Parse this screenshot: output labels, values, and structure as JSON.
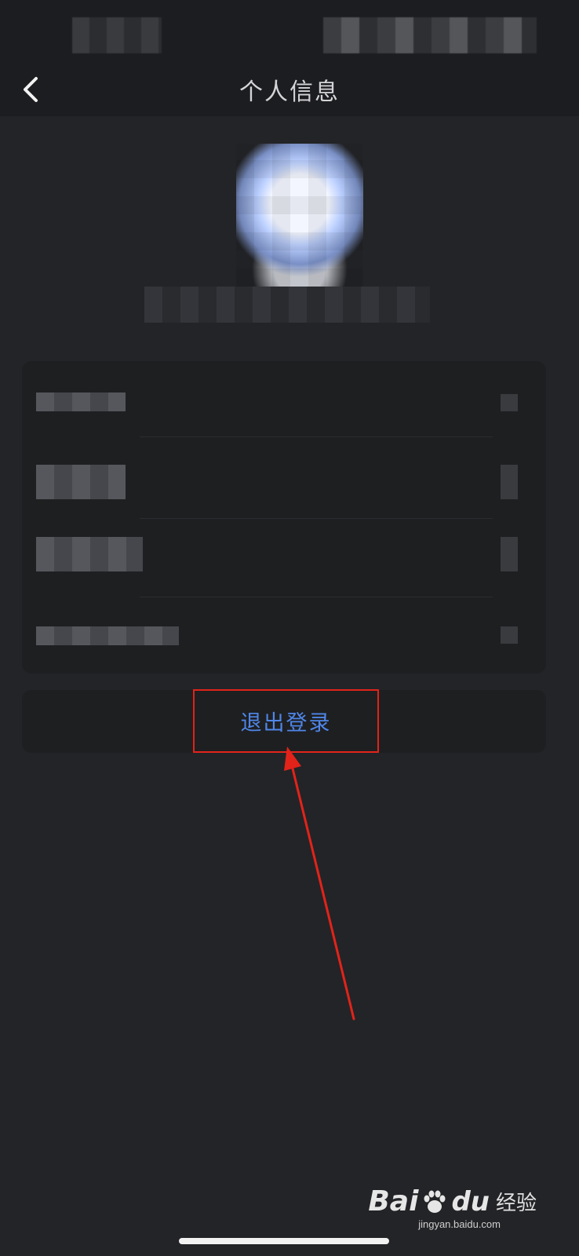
{
  "nav": {
    "title": "个人信息"
  },
  "logout": {
    "label": "退出登录"
  },
  "watermark": {
    "brand_left": "Bai",
    "brand_right": "du",
    "product": "经验",
    "url": "jingyan.baidu.com"
  },
  "colors": {
    "background": "#232427",
    "card": "#1e1f21",
    "accent_blue": "#4f86e8",
    "highlight_red": "#e2231a"
  },
  "icons": {
    "back": "chevron-left-icon",
    "row_arrow": "chevron-right-icon"
  }
}
